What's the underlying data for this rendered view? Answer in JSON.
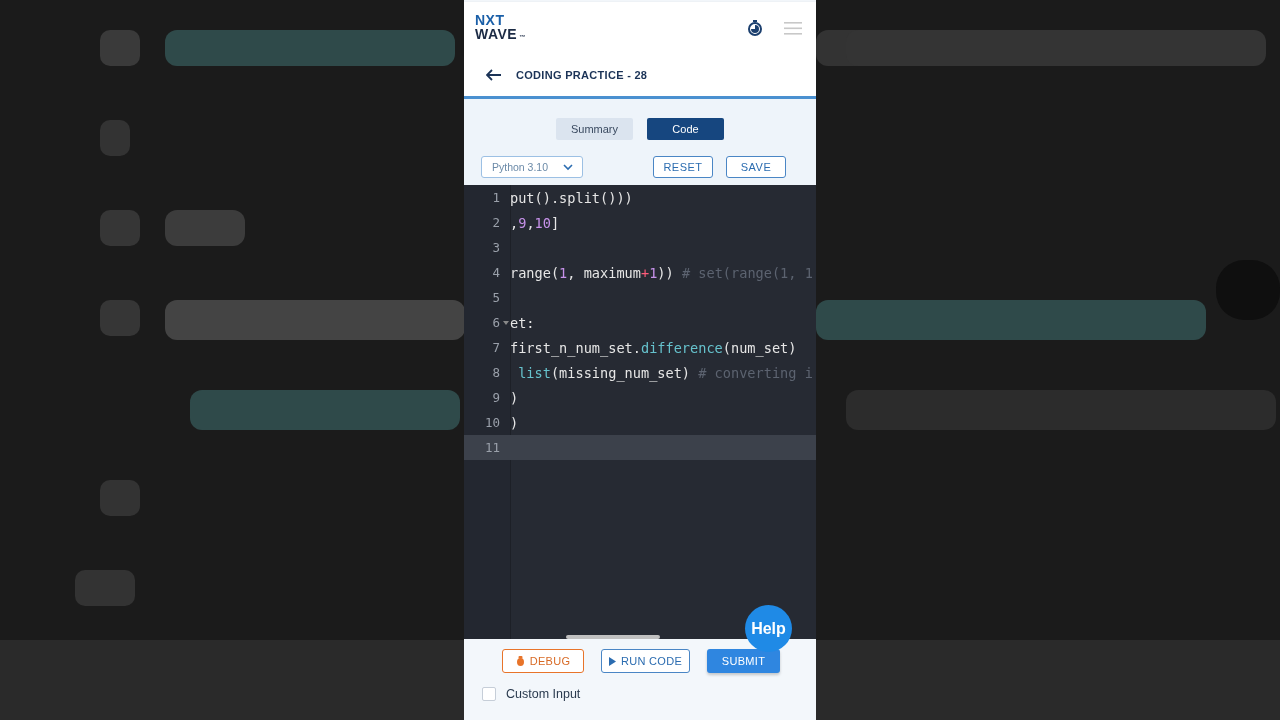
{
  "logo": {
    "top": "NXT",
    "bottom": "WAVE",
    "mark": "™"
  },
  "header": {
    "title": "CODING PRACTICE - 28"
  },
  "tabs": [
    {
      "label": "Summary",
      "selected": false
    },
    {
      "label": "Code",
      "selected": true
    }
  ],
  "language_select": {
    "value": "Python 3.10"
  },
  "actions": [
    "RESET",
    "SAVE"
  ],
  "editor": {
    "lines": [
      {
        "number": "1",
        "fold": false,
        "active": false,
        "segments": [
          {
            "text": "put().split()))",
            "kind": "plain"
          }
        ]
      },
      {
        "number": "2",
        "fold": false,
        "active": false,
        "segments": [
          {
            "text": ",",
            "kind": "plain"
          },
          {
            "text": "9",
            "kind": "num"
          },
          {
            "text": ",",
            "kind": "plain"
          },
          {
            "text": "10",
            "kind": "num"
          },
          {
            "text": "]",
            "kind": "plain"
          }
        ]
      },
      {
        "number": "3",
        "fold": false,
        "active": false
      },
      {
        "number": "4",
        "fold": false,
        "active": false,
        "segments": [
          {
            "text": "range(",
            "kind": "plain"
          },
          {
            "text": "1",
            "kind": "num"
          },
          {
            "text": ", maximum",
            "kind": "plain"
          },
          {
            "text": "+",
            "kind": "op"
          },
          {
            "text": "1",
            "kind": "num"
          },
          {
            "text": ")) ",
            "kind": "plain"
          },
          {
            "text": "# set(range(1, 1",
            "kind": "comment"
          }
        ]
      },
      {
        "number": "5",
        "fold": false,
        "active": false
      },
      {
        "number": "6",
        "fold": true,
        "active": false,
        "segments": [
          {
            "text": "et:",
            "kind": "plain"
          }
        ]
      },
      {
        "number": "7",
        "fold": false,
        "active": false,
        "segments": [
          {
            "text": "first_n_num_set.",
            "kind": "plain"
          },
          {
            "text": "difference",
            "kind": "func"
          },
          {
            "text": "(num_set)",
            "kind": "plain"
          }
        ]
      },
      {
        "number": "8",
        "fold": false,
        "active": false,
        "segments": [
          {
            "text": " list",
            "kind": "func"
          },
          {
            "text": "(missing_num_set) ",
            "kind": "plain"
          },
          {
            "text": "# converting i",
            "kind": "comment"
          }
        ]
      },
      {
        "number": "9",
        "fold": false,
        "active": false,
        "segments": [
          {
            "text": ")",
            "kind": "plain"
          }
        ]
      },
      {
        "number": "10",
        "fold": false,
        "active": false,
        "segments": [
          {
            "text": ")",
            "kind": "plain"
          }
        ]
      },
      {
        "number": "11",
        "fold": false,
        "active": true
      }
    ]
  },
  "footer": {
    "buttons": [
      {
        "label": "DEBUG",
        "kind": "debug"
      },
      {
        "label": "RUN CODE",
        "kind": "run"
      },
      {
        "label": "SUBMIT",
        "kind": "submit"
      }
    ],
    "custom_input": {
      "label": "Custom Input",
      "checked": false
    }
  },
  "help": {
    "label": "Help"
  }
}
